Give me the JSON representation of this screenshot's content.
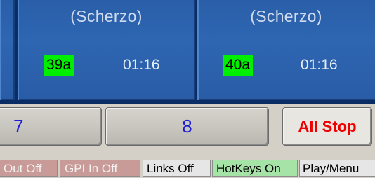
{
  "carts": [
    {
      "title": "(Scherzo)",
      "number": "39a",
      "time": "01:16"
    },
    {
      "title": "(Scherzo)",
      "number": "40a",
      "time": "01:16"
    }
  ],
  "buttons": {
    "seven": "7",
    "eight": "8",
    "all_stop": "All Stop"
  },
  "status": {
    "out": "Out Off",
    "gpi_in": "GPI In Off",
    "links": "Links Off",
    "hotkeys": "HotKeys On",
    "play_menu": "Play/Menu"
  },
  "colors": {
    "cart_bg": "#2e66b2",
    "cart_number_bg": "#00ee00",
    "button_text": "#1b1bd8",
    "all_stop_text": "#ee0000",
    "status_off_bg": "#c99b98",
    "status_on_bg": "#a6e3a6"
  }
}
